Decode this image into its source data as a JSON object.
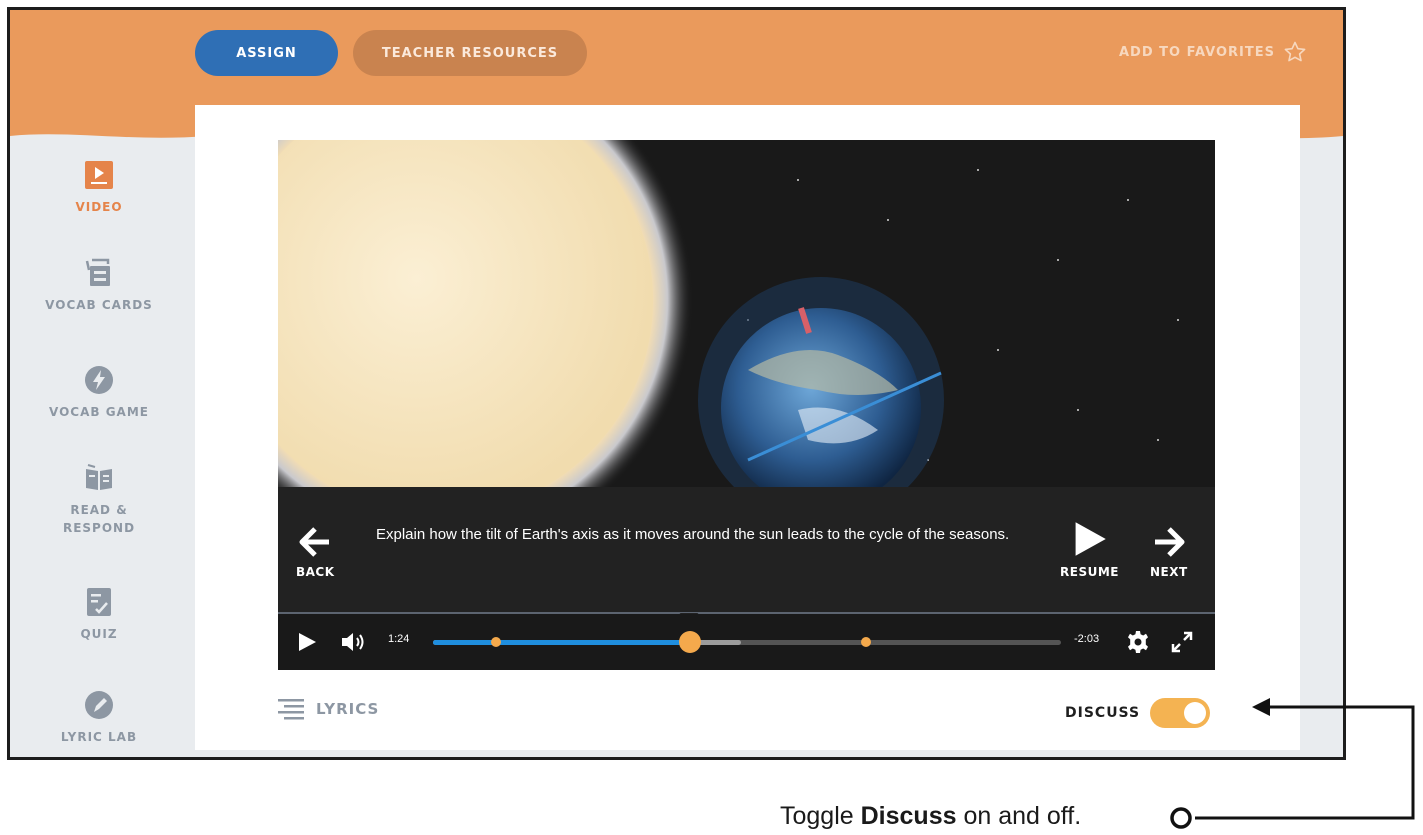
{
  "header": {
    "assign_label": "ASSIGN",
    "resources_label": "TEACHER RESOURCES",
    "favorites_label": "ADD TO FAVORITES",
    "favorites_icon": "star-outline-icon",
    "color_bar": "#ea9a5c",
    "color_assign": "#2f6fb5"
  },
  "sidebar": {
    "items": [
      {
        "label": "VIDEO",
        "icon": "video-icon",
        "active": true
      },
      {
        "label": "VOCAB CARDS",
        "icon": "vocab-cards-icon",
        "active": false
      },
      {
        "label": "VOCAB GAME",
        "icon": "lightning-icon",
        "active": false
      },
      {
        "label": "READ &\nRESPOND",
        "icon": "open-book-icon",
        "active": false
      },
      {
        "label": "QUIZ",
        "icon": "checklist-icon",
        "active": false
      },
      {
        "label": "LYRIC LAB",
        "icon": "pencil-circle-icon",
        "active": false
      }
    ],
    "active_color": "#e5844a"
  },
  "player": {
    "prompt": "Explain how the tilt of Earth's axis as it moves around the sun leads to the cycle of the seasons.",
    "back_label": "BACK",
    "resume_label": "RESUME",
    "next_label": "NEXT",
    "current_time": "1:24",
    "remaining_time": "-2:03",
    "progress_fraction": 0.41,
    "buffered_fraction": 0.49,
    "chapter_markers": [
      0.1,
      0.69
    ],
    "accent_color": "#f4a94c",
    "progress_color": "#1f8ede"
  },
  "footer": {
    "lyrics_label": "LYRICS",
    "discuss_label": "DISCUSS",
    "discuss_on": true
  },
  "callout": {
    "before": "Toggle ",
    "bold": "Discuss",
    "after": " on and off."
  }
}
